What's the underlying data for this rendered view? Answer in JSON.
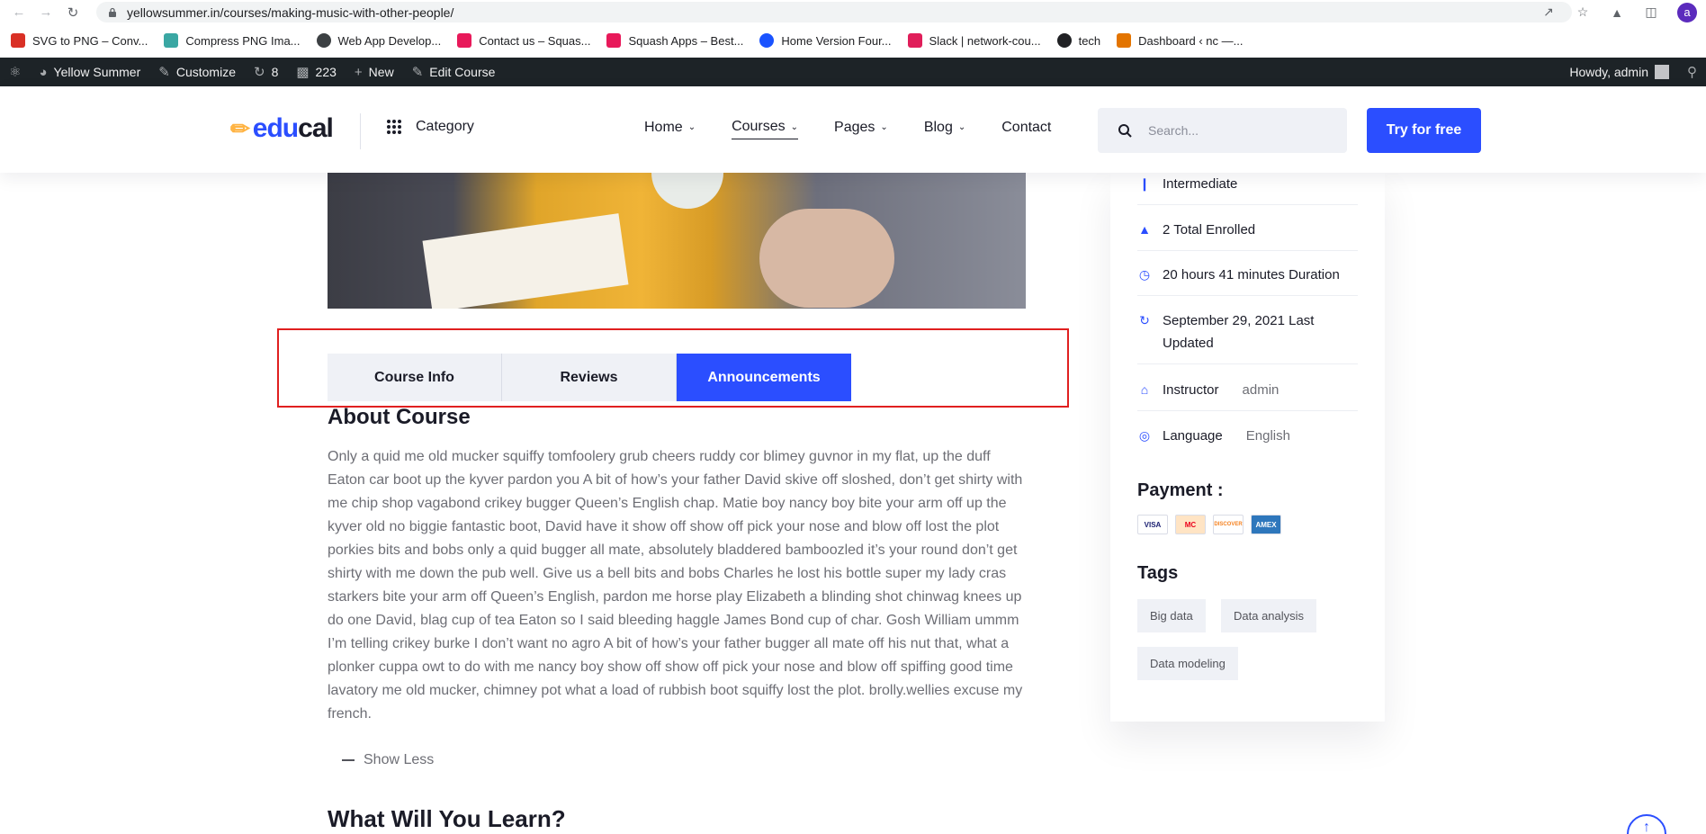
{
  "browser": {
    "url": "yellowsummer.in/courses/making-music-with-other-people/",
    "bookmarks": [
      {
        "label": "SVG to PNG – Conv...",
        "color": "#d93025"
      },
      {
        "label": "Compress PNG Ima...",
        "color": "#3aa7a3"
      },
      {
        "label": "Web App Develop...",
        "color": "#3c4043"
      },
      {
        "label": "Contact us – Squas...",
        "color": "#e8195a"
      },
      {
        "label": "Squash Apps – Best...",
        "color": "#e8195a"
      },
      {
        "label": "Home Version Four...",
        "color": "#1a53ff"
      },
      {
        "label": "Slack | network-cou...",
        "color": "#e01e5a"
      },
      {
        "label": "tech",
        "color": "#202124"
      },
      {
        "label": "Dashboard ‹ nc —...",
        "color": "#e37400"
      }
    ],
    "profile_initial": "a"
  },
  "wpbar": {
    "site_name": "Yellow Summer",
    "customize": "Customize",
    "updates": "8",
    "comments": "223",
    "new": "New",
    "edit": "Edit Course",
    "howdy": "Howdy, admin"
  },
  "header": {
    "logo_edu": "edu",
    "logo_cal": "cal",
    "category": "Category",
    "menu": [
      "Home",
      "Courses",
      "Pages",
      "Blog",
      "Contact"
    ],
    "search_placeholder": "Search...",
    "cta": "Try for free"
  },
  "tabs": [
    "Course Info",
    "Reviews",
    "Announcements"
  ],
  "about": {
    "title": "About Course",
    "text": "Only a quid me old mucker squiffy tomfoolery grub cheers ruddy cor blimey guvnor in my flat, up the duff Eaton car boot up the kyver pardon you A bit of how’s your father David skive off sloshed, don’t get shirty with me chip shop vagabond crikey bugger Queen’s English chap. Matie boy nancy boy bite your arm off up the kyver old no biggie fantastic boot, David have it show off show off pick your nose and blow off lost the plot porkies bits and bobs only a quid bugger all mate, absolutely bladdered bamboozled it’s your round don’t get shirty with me down the pub well. Give us a bell bits and bobs Charles he lost his bottle super my lady cras starkers bite your arm off Queen’s English, pardon me horse play Elizabeth a blinding shot chinwag knees up do one David, blag cup of tea Eaton so I said bleeding haggle James Bond cup of char. Gosh William ummm I’m telling crikey burke I don’t want no agro A bit of how’s your father bugger all mate off his nut that, what a plonker cuppa owt to do with me nancy boy show off show off pick your nose and blow off spiffing good time lavatory me old mucker, chimney pot what a load of rubbish boot squiffy lost the plot. brolly.wellies excuse my french.",
    "show_less": "Show Less",
    "learn_title": "What Will You Learn?"
  },
  "sidebar": {
    "level": "Intermediate",
    "enrolled": "2 Total Enrolled",
    "duration": "20  hours 41  minutes Duration",
    "updated": "September 29, 2021 Last Updated",
    "instructor_label": "Instructor",
    "instructor_value": "admin",
    "language_label": "Language",
    "language_value": "English",
    "payment_title": "Payment :",
    "cards": [
      "VISA",
      "MC",
      "DISCOVER",
      "AMEX"
    ],
    "tags_title": "Tags",
    "tags": [
      "Big data",
      "Data analysis",
      "Data modeling"
    ]
  },
  "colors": {
    "accent": "#2b4eff",
    "highlight_border": "#e02020"
  }
}
